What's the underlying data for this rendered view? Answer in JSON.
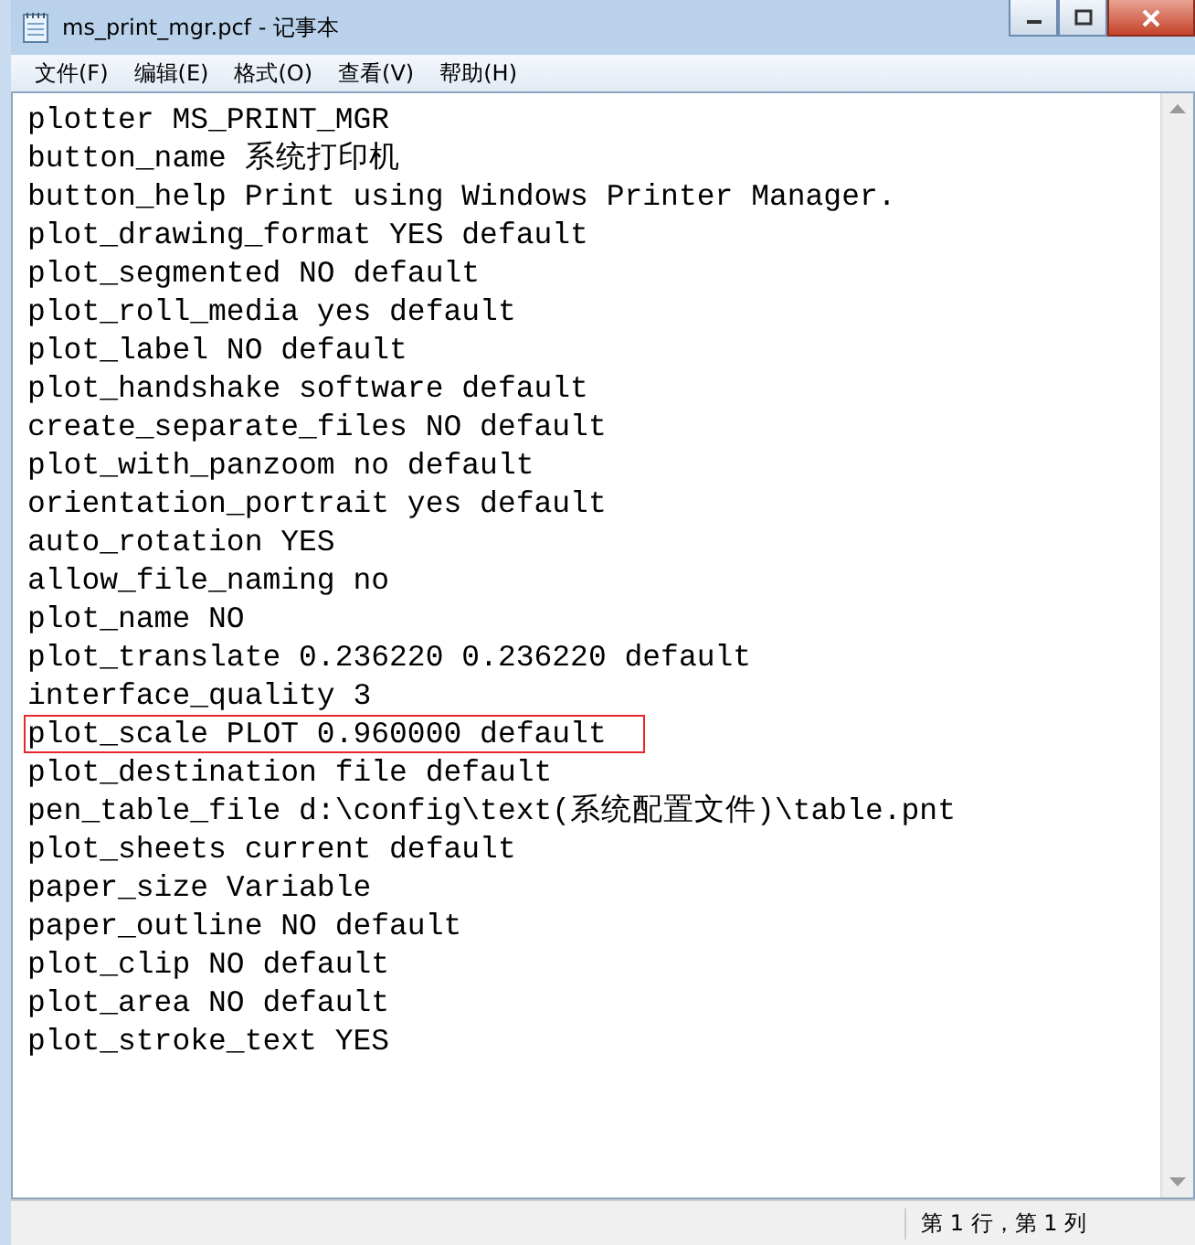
{
  "window": {
    "title": "ms_print_mgr.pcf - 记事本"
  },
  "menu": [
    "文件(F)",
    "编辑(E)",
    "格式(O)",
    "查看(V)",
    "帮助(H)"
  ],
  "lines": [
    {
      "text": "plotter MS_PRINT_MGR",
      "highlighted": false
    },
    {
      "text": "button_name 系统打印机",
      "highlighted": false
    },
    {
      "text": "button_help Print using Windows Printer Manager.",
      "highlighted": false
    },
    {
      "text": "plot_drawing_format YES default",
      "highlighted": false
    },
    {
      "text": "plot_segmented NO default",
      "highlighted": false
    },
    {
      "text": "plot_roll_media yes default",
      "highlighted": false
    },
    {
      "text": "plot_label NO default",
      "highlighted": false
    },
    {
      "text": "plot_handshake software default",
      "highlighted": false
    },
    {
      "text": "create_separate_files NO default",
      "highlighted": false
    },
    {
      "text": "plot_with_panzoom no default",
      "highlighted": false
    },
    {
      "text": "orientation_portrait yes default",
      "highlighted": false
    },
    {
      "text": "auto_rotation YES",
      "highlighted": false
    },
    {
      "text": "allow_file_naming no",
      "highlighted": false
    },
    {
      "text": "plot_name NO",
      "highlighted": false
    },
    {
      "text": "plot_translate 0.236220 0.236220 default",
      "highlighted": false
    },
    {
      "text": "interface_quality 3",
      "highlighted": false
    },
    {
      "text": "plot_scale PLOT 0.960000 default",
      "highlighted": true
    },
    {
      "text": "plot_destination file default",
      "highlighted": false
    },
    {
      "text": "pen_table_file d:\\config\\text(系统配置文件)\\table.pnt",
      "highlighted": false
    },
    {
      "text": "plot_sheets current default",
      "highlighted": false
    },
    {
      "text": "paper_size Variable",
      "highlighted": false
    },
    {
      "text": "paper_outline NO default",
      "highlighted": false
    },
    {
      "text": "plot_clip NO default",
      "highlighted": false
    },
    {
      "text": "plot_area NO default",
      "highlighted": false
    },
    {
      "text": "plot_stroke_text YES",
      "highlighted": false
    }
  ],
  "status_bar": {
    "position": "第 1 行，第 1 列"
  }
}
